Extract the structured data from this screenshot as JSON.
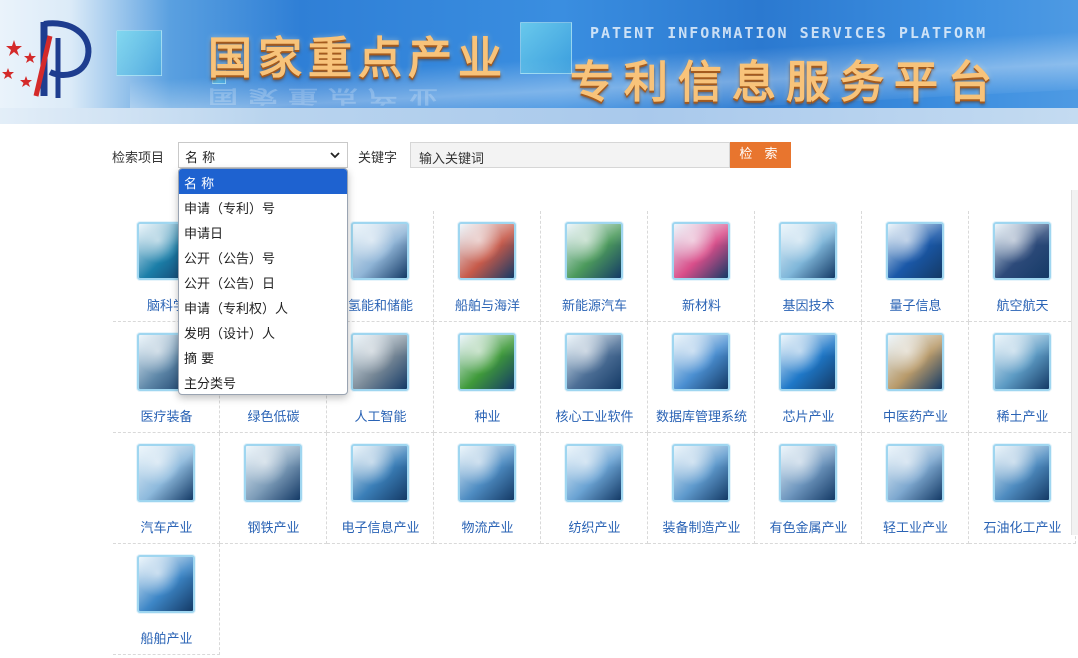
{
  "banner": {
    "title_main": "国家重点产业",
    "title_sub": "专利信息服务平台",
    "title_en": "PATENT INFORMATION SERVICES PLATFORM"
  },
  "search": {
    "field_label": "检索项目",
    "selected_field": "名 称",
    "keyword_label": "关键字",
    "keyword_placeholder": "输入关键词",
    "button_label": "检 索",
    "options": [
      "名 称",
      "申请（专利）号",
      "申请日",
      "公开（公告）号",
      "公开（公告）日",
      "申请（专利权）人",
      "发明（设计）人",
      "摘 要",
      "主分类号"
    ]
  },
  "industries": [
    {
      "label": "脑科学",
      "icon": "brain-icon",
      "color": "#1b7ea8"
    },
    {
      "label": "",
      "icon": "tile-icon",
      "color": "#7aa6c8"
    },
    {
      "label": "氢能和储能",
      "icon": "hydrogen-tank-icon",
      "color": "#8fb4d6"
    },
    {
      "label": "船舶与海洋",
      "icon": "ship-ocean-icon",
      "color": "#c75a4a"
    },
    {
      "label": "新能源汽车",
      "icon": "ev-charging-icon",
      "color": "#4c9a5c"
    },
    {
      "label": "新材料",
      "icon": "new-material-icon",
      "color": "#d94e8a"
    },
    {
      "label": "基因技术",
      "icon": "dna-icon",
      "color": "#7fb6d9"
    },
    {
      "label": "量子信息",
      "icon": "quantum-icon",
      "color": "#1a58a8"
    },
    {
      "label": "航空航天",
      "icon": "spacecraft-icon",
      "color": "#2d4a7a"
    },
    {
      "label": "医疗装备",
      "icon": "medical-equipment-icon",
      "color": "#5e87a8"
    },
    {
      "label": "绿色低碳",
      "icon": "green-carbon-icon",
      "color": "#6aa071"
    },
    {
      "label": "人工智能",
      "icon": "robot-icon",
      "color": "#7a8a98"
    },
    {
      "label": "种业",
      "icon": "seedling-icon",
      "color": "#3f9a3a"
    },
    {
      "label": "核心工业软件",
      "icon": "industrial-software-icon",
      "color": "#4d6f96"
    },
    {
      "label": "数据库管理系统",
      "icon": "database-icon",
      "color": "#4b8fd1"
    },
    {
      "label": "芯片产业",
      "icon": "chip-icon",
      "color": "#1f78c8"
    },
    {
      "label": "中医药产业",
      "icon": "herbal-medicine-icon",
      "color": "#b89a6a"
    },
    {
      "label": "稀土产业",
      "icon": "rare-earth-icon",
      "color": "#5d9bc4"
    },
    {
      "label": "汽车产业",
      "icon": "car-icon",
      "color": "#8db9dc"
    },
    {
      "label": "钢铁产业",
      "icon": "steel-icon",
      "color": "#7d9cb8"
    },
    {
      "label": "电子信息产业",
      "icon": "electronics-icon",
      "color": "#3b7fb8"
    },
    {
      "label": "物流产业",
      "icon": "logistics-icon",
      "color": "#4e8cc2"
    },
    {
      "label": "纺织产业",
      "icon": "textile-icon",
      "color": "#6ba3d3"
    },
    {
      "label": "装备制造产业",
      "icon": "gears-icon",
      "color": "#5f9acd"
    },
    {
      "label": "有色金属产业",
      "icon": "metal-icon",
      "color": "#6d95bd"
    },
    {
      "label": "轻工业产业",
      "icon": "light-industry-icon",
      "color": "#7ea8cf"
    },
    {
      "label": "石油化工产业",
      "icon": "petrochemical-icon",
      "color": "#4f8cc0"
    },
    {
      "label": "船舶产业",
      "icon": "ship-icon",
      "color": "#3d86c6"
    }
  ]
}
